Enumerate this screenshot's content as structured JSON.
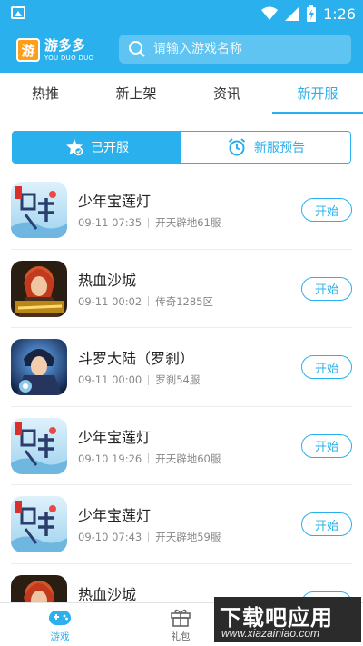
{
  "status_bar": {
    "time": "1:26"
  },
  "header": {
    "logo_text": "游多多",
    "logo_subtext": "YOU DUO DUO",
    "logo_badge": "游",
    "search_placeholder": "请输入游戏名称"
  },
  "tabs": [
    {
      "label": "热推",
      "active": false
    },
    {
      "label": "新上架",
      "active": false
    },
    {
      "label": "资讯",
      "active": false
    },
    {
      "label": "新开服",
      "active": true
    }
  ],
  "segment": {
    "opened_label": "已开服",
    "upcoming_label": "新服预告"
  },
  "games": [
    {
      "name": "少年宝莲灯",
      "time": "09-11 07:35",
      "server": "开天辟地61服",
      "button": "开始",
      "icon": "baolian-icon"
    },
    {
      "name": "热血沙城",
      "time": "09-11 00:02",
      "server": "传奇1285区",
      "button": "开始",
      "icon": "rexue-icon"
    },
    {
      "name": "斗罗大陆（罗刹）",
      "time": "09-11 00:00",
      "server": "罗刹54服",
      "button": "开始",
      "icon": "douluo-icon"
    },
    {
      "name": "少年宝莲灯",
      "time": "09-10 19:26",
      "server": "开天辟地60服",
      "button": "开始",
      "icon": "baolian-icon"
    },
    {
      "name": "少年宝莲灯",
      "time": "09-10 07:43",
      "server": "开天辟地59服",
      "button": "开始",
      "icon": "baolian-icon"
    },
    {
      "name": "热血沙城",
      "time": "",
      "server": "",
      "button": "开始",
      "icon": "rexue-icon"
    }
  ],
  "bottom_nav": {
    "games_label": "游戏",
    "gifts_label": "礼包"
  },
  "watermark": {
    "main": "下载吧应用",
    "sub": "www.xiazainiao.com"
  },
  "colors": {
    "accent": "#2ab0ec",
    "text": "#222222",
    "muted": "#888888"
  }
}
